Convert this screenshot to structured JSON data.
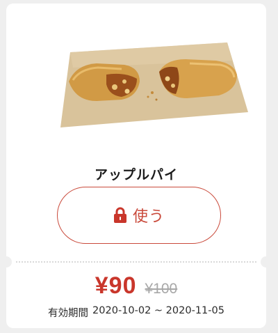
{
  "product": {
    "name": "アップルパイ",
    "image_icon": "apple-pie-image"
  },
  "action": {
    "label": "使う",
    "icon": "lock-icon",
    "color": "#c9493a"
  },
  "price": {
    "current": "¥90",
    "original": "¥100",
    "current_color": "#c9362b"
  },
  "validity": {
    "label": "有効期間",
    "range": "2020-10-02 ~ 2020-11-05"
  }
}
